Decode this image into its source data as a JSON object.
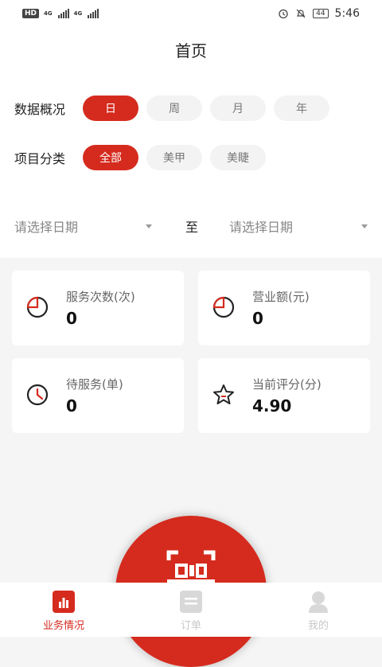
{
  "status_bar": {
    "hd": "HD",
    "net1": "4G",
    "net2": "4G",
    "battery": "44",
    "time": "5:46"
  },
  "header": {
    "title": "首页"
  },
  "filters": {
    "period_label": "数据概况",
    "periods": [
      "日",
      "周",
      "月",
      "年"
    ],
    "active_period": "日",
    "category_label": "项目分类",
    "categories": [
      "全部",
      "美甲",
      "美睫"
    ],
    "active_category": "全部"
  },
  "date_range": {
    "start_placeholder": "请选择日期",
    "separator": "至",
    "end_placeholder": "请选择日期"
  },
  "stats": [
    {
      "label": "服务次数(次)",
      "value": "0",
      "icon": "pie-chart-icon"
    },
    {
      "label": "营业额(元)",
      "value": "0",
      "icon": "pie-chart-icon"
    },
    {
      "label": "待服务(单)",
      "value": "0",
      "icon": "clock-icon"
    },
    {
      "label": "当前评分(分)",
      "value": "4.90",
      "icon": "star-icon"
    }
  ],
  "tabs": [
    {
      "label": "业务情况",
      "icon": "bar-chart-icon",
      "active": true
    },
    {
      "label": "订单",
      "icon": "order-list-icon",
      "active": false
    },
    {
      "label": "我的",
      "icon": "user-icon",
      "active": false
    }
  ],
  "colors": {
    "accent": "#d52b1e",
    "inactive_tab": "#c8c8c8"
  }
}
